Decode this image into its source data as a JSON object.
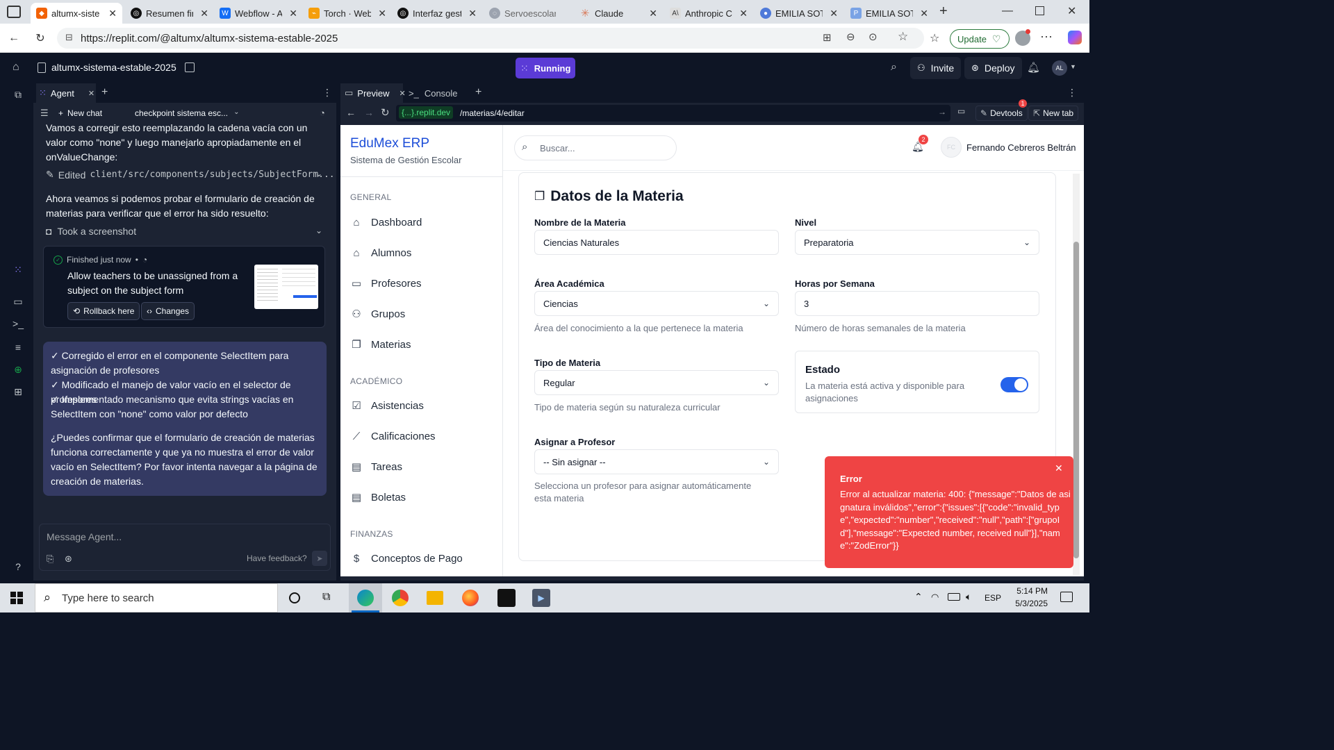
{
  "browser": {
    "tabs": [
      {
        "label": "altumx-siste",
        "active": true,
        "icon_color": "#f26207"
      },
      {
        "label": "Resumen fin",
        "icon_color": "#111"
      },
      {
        "label": "Webflow - A",
        "icon_color": "#146ef5"
      },
      {
        "label": "Torch · Webf",
        "icon_color": "#f59e0b"
      },
      {
        "label": "Interfaz gest",
        "icon_color": "#111"
      },
      {
        "label": "Servoescolar",
        "icon_color": "#9ca3af"
      },
      {
        "label": "Claude",
        "icon_color": "#d97757"
      },
      {
        "label": "Anthropic C",
        "icon_color": "#555"
      },
      {
        "label": "EMILIA SOTO",
        "icon_color": "#4f7ad9"
      },
      {
        "label": "EMILIA SOTO",
        "icon_color": "#7aa3e5"
      }
    ],
    "url": "https://replit.com/@altumx/altumx-sistema-estable-2025",
    "update_label": "Update"
  },
  "replit": {
    "project_name": "altumx-sistema-estable-2025",
    "status": "Running",
    "invite_label": "Invite",
    "deploy_label": "Deploy",
    "avatar_initials": "AL"
  },
  "agent": {
    "tab_label": "Agent",
    "new_chat_label": "New chat",
    "checkpoint_label": "checkpoint sistema esc...",
    "messages": {
      "m1": "Vamos a corregir esto reemplazando la cadena vacía con un valor como \"none\" y luego manejarlo apropiadamente en el onValueChange:",
      "edited_prefix": "Edited",
      "edited_path": "client/src/components/subjects/SubjectForm...",
      "m2": "Ahora veamos si podemos probar el formulario de creación de materias para verificar que el error ha sido resuelto:",
      "screenshot_label": "Took a screenshot"
    },
    "checkpoint": {
      "status": "Finished just now",
      "title": "Allow teachers to be unassigned from a subject on the subject form",
      "rollback_label": "Rollback here",
      "changes_label": "Changes"
    },
    "summary": {
      "line1": "✓ Corregido el error en el componente SelectItem para asignación de profesores",
      "line2": "✓ Modificado el manejo de valor vacío en el selector de profesores",
      "line3": "✓ Implementado mecanismo que evita strings vacías en SelectItem con \"none\" como valor por defecto",
      "question": "¿Puedes confirmar que el formulario de creación de materias funciona correctamente y que ya no muestra el error de valor vacío en SelectItem? Por favor intenta navegar a la página de creación de materias."
    },
    "input_placeholder": "Message Agent...",
    "feedback_label": "Have feedback?"
  },
  "preview": {
    "tab_preview": "Preview",
    "tab_console": "Console",
    "domain": "{...}.replit.dev",
    "path": "/materias/4/editar",
    "devtools_label": "Devtools",
    "devtools_badge": "1",
    "newtab_label": "New tab"
  },
  "app": {
    "brand": "EduMex ERP",
    "subtitle": "Sistema de Gestión Escolar",
    "search_placeholder": "Buscar...",
    "notif_count": "2",
    "user_name": "Fernando Cebreros Beltrán",
    "user_initials": "FC",
    "sections": {
      "general": "GENERAL",
      "academico": "ACADÉMICO",
      "finanzas": "FINANZAS"
    },
    "nav": {
      "dashboard": "Dashboard",
      "alumnos": "Alumnos",
      "profesores": "Profesores",
      "grupos": "Grupos",
      "materias": "Materias",
      "asistencias": "Asistencias",
      "calificaciones": "Calificaciones",
      "tareas": "Tareas",
      "boletas": "Boletas",
      "conceptos": "Conceptos de Pago"
    },
    "form": {
      "title": "Datos de la Materia",
      "nombre_label": "Nombre de la Materia",
      "nombre_value": "Ciencias Naturales",
      "nivel_label": "Nivel",
      "nivel_value": "Preparatoria",
      "area_label": "Área Académica",
      "area_value": "Ciencias",
      "area_help": "Área del conocimiento a la que pertenece la materia",
      "horas_label": "Horas por Semana",
      "horas_value": "3",
      "horas_help": "Número de horas semanales de la materia",
      "tipo_label": "Tipo de Materia",
      "tipo_value": "Regular",
      "tipo_help": "Tipo de materia según su naturaleza curricular",
      "estado_label": "Estado",
      "estado_help": "La materia está activa y disponible para asignaciones",
      "estado_on": true,
      "profesor_label": "Asignar a Profesor",
      "profesor_value": "-- Sin asignar --",
      "profesor_help": "Selecciona un profesor para asignar automáticamente esta materia"
    },
    "toast": {
      "title": "Error",
      "message": "Error al actualizar materia: 400: {\"message\":\"Datos de asignatura inválidos\",\"error\":{\"issues\":[{\"code\":\"invalid_type\",\"expected\":\"number\",\"received\":\"null\",\"path\":[\"grupoId\"],\"message\":\"Expected number, received null\"}],\"name\":\"ZodError\"}}"
    }
  },
  "taskbar": {
    "search_placeholder": "Type here to search",
    "lang": "ESP",
    "time": "5:14 PM",
    "date": "5/3/2025"
  },
  "colors": {
    "replit_bg": "#0e1525",
    "replit_panel": "#1c2333",
    "running": "#5b3bd6",
    "brand_blue": "#1d4ed8",
    "toast_red": "#ef4444",
    "toggle_blue": "#2563eb"
  }
}
